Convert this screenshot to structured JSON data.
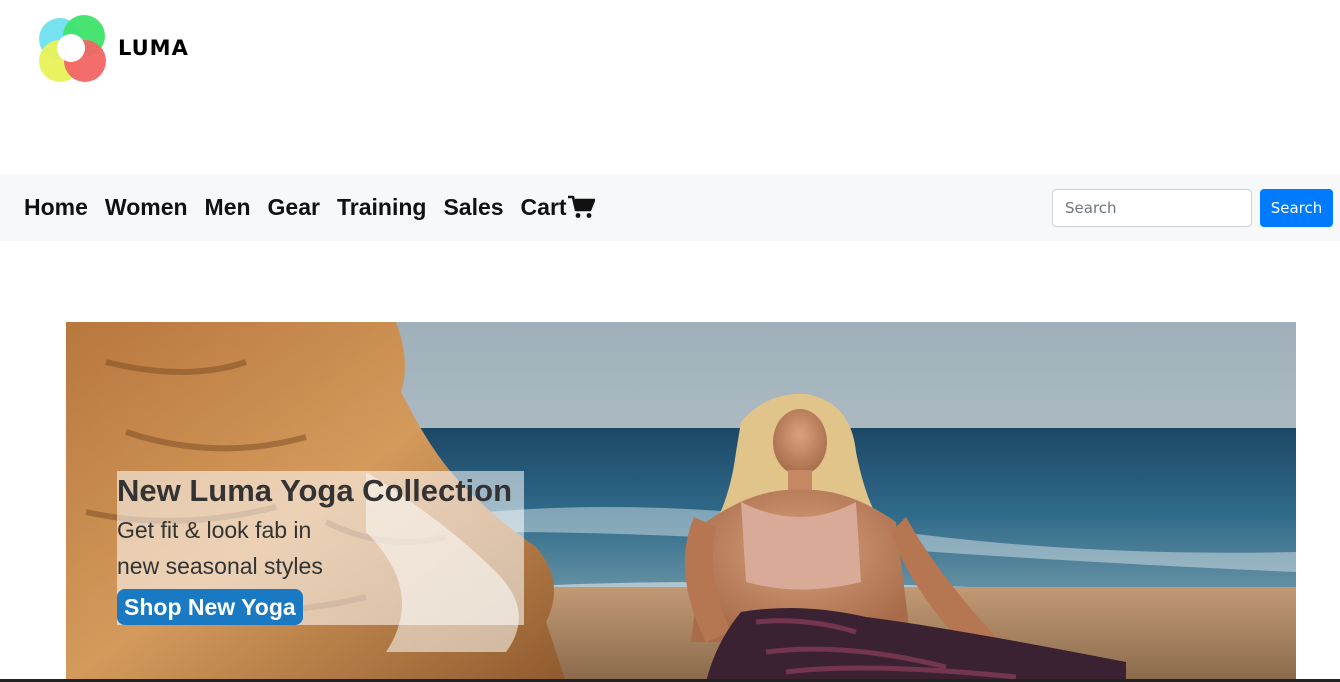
{
  "brand": {
    "name": "LUMA"
  },
  "nav": {
    "items": [
      "Home",
      "Women",
      "Men",
      "Gear",
      "Training",
      "Sales"
    ],
    "cart_label": "Cart",
    "cart_icon": "cart-icon"
  },
  "search": {
    "placeholder": "Search",
    "button_label": "Search"
  },
  "hero": {
    "title": "New Luma Yoga Collection",
    "line1": "Get fit & look fab in",
    "line2": "new seasonal styles",
    "cta": "Shop New Yoga"
  },
  "colors": {
    "primary": "#007bff",
    "cta": "#1979c3",
    "navbar_bg": "#f7f8f9"
  }
}
